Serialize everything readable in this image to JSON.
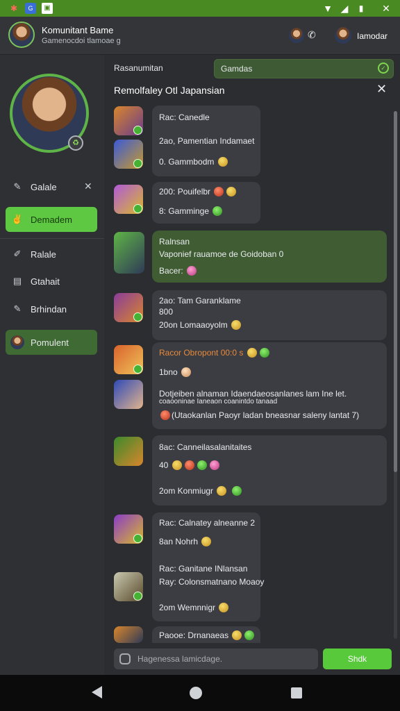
{
  "header": {
    "title": "Komunitant Bame",
    "subtitle": "Gamenocdoi tlamoae g",
    "user_name": "Iamodar"
  },
  "sidebar": {
    "items": [
      {
        "label": "Galale",
        "icon": "pen-icon"
      },
      {
        "label": "Demadem",
        "icon": "wave-icon",
        "active": true
      },
      {
        "label": "Ralale",
        "icon": "pen-icon"
      },
      {
        "label": "Gtahait",
        "icon": "board-icon"
      },
      {
        "label": "Brhindan",
        "icon": "pen-icon"
      },
      {
        "label": "Pomulent",
        "icon": "avatar"
      }
    ]
  },
  "search": {
    "label": "Rasanumitan",
    "value": "Gamdas"
  },
  "room": {
    "title": "Remolfaley Otl Japansian"
  },
  "messages": [
    {
      "lines": [
        "Rac: Canedle",
        "2ao, Pamentian Indamaet",
        "0. Gammbodm"
      ]
    },
    {
      "lines": [
        "200: Pouifelbr",
        "8: Gamminge"
      ]
    },
    {
      "lines": [
        "Ralnsan",
        "Vaponief rauamoe de Goidoban 0",
        "Bacer:"
      ]
    },
    {
      "lines": [
        "2ao: Tam Garanklame",
        "800",
        "20on Lomaaoyolm"
      ]
    },
    {
      "lines": [
        "Racor Obropont 00:0 s",
        "1bno",
        "Dotjeiben alnaman Idaendaeosanlanes lam Ine let.",
        "coaooninae Ianeaon coanintdo tanaad",
        "(Utaokanlan Paoyr ladan bneasnar saleny lantat 7)"
      ]
    },
    {
      "lines": [
        "8ac: Canneilasalanitaites",
        "40",
        "2om Konmiugr"
      ]
    },
    {
      "lines": [
        "Rac: Calnatey alneanne 2",
        "8an Nohrh",
        "Rac: Ganitane INlansan",
        "Ray: Colonsmatnano Moaoy",
        "2om Wemnnigr"
      ]
    },
    {
      "lines": [
        "Paooe: Drnanaeas"
      ]
    }
  ],
  "composer": {
    "placeholder": "Hagenessa lamicdage.",
    "send_label": "Shdk"
  },
  "colors": {
    "accent": "#58c93b",
    "status_bar": "#4a8a22",
    "bubble": "#3b3d42",
    "bubble_highlight": "#3f5c33"
  }
}
